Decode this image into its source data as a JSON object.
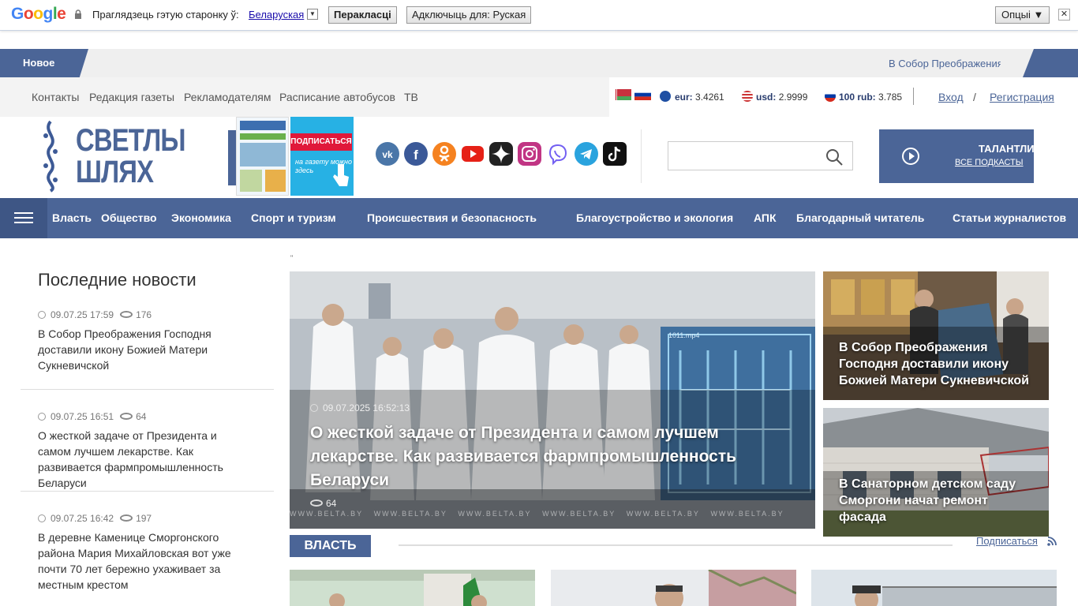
{
  "translate_bar": {
    "logo": "Google",
    "prompt": "Праглядзець гэтую старонку ў:",
    "language": "Беларуская",
    "translate_button": "Перакласці",
    "disable_button": "Адключыць для: Руская",
    "options_button": "Опцыі ▼",
    "close_label": "✕"
  },
  "ticker": {
    "label": "Новое",
    "text": "В Собор Преображения Господня доставили икону Божией Матери Сукневичской"
  },
  "top_links": [
    "Контакты",
    "Редакция газеты",
    "Рекламодателям",
    "Расписание автобусов",
    "ТВ"
  ],
  "rates": {
    "eur_label": "eur:",
    "eur_value": "3.4261",
    "usd_label": "usd:",
    "usd_value": "2.9999",
    "rub_label": "100 rub:",
    "rub_value": "3.785",
    "login": "Вход",
    "slash": "/",
    "register": "Регистрация"
  },
  "logo": {
    "line1": "СВЕТЛЫ",
    "line2": "ШЛЯХ"
  },
  "promo": {
    "subscribe": "ПОДПИСАТЬСЯ",
    "hint": "на газету можно здесь"
  },
  "socials": [
    "vk-icon",
    "facebook-icon",
    "odnoklassniki-icon",
    "youtube-icon",
    "dzen-icon",
    "instagram-icon",
    "viber-icon",
    "telegram-icon",
    "tiktok-icon"
  ],
  "search": {
    "placeholder": ""
  },
  "podcast": {
    "title": "ТАЛАНТЛИВЫЕ",
    "all_link": "ВСЕ ПОДКАСТЫ"
  },
  "nav": [
    "Власть",
    "Общество",
    "Экономика",
    "Спорт и туризм",
    "Происшествия и безопасность",
    "Благоустройство и экология",
    "АПК",
    "Благодарный читатель",
    "Статьи журналистов"
  ],
  "last_news": {
    "title": "Последние новости",
    "items": [
      {
        "date": "09.07.25 17:59",
        "views": "176",
        "title": "В Собор Преображения Господня доставили икону Божией Матери Сукневичской"
      },
      {
        "date": "09.07.25 16:51",
        "views": "64",
        "title": "О жесткой задаче от Президента и самом лучшем лекарстве. Как развивается фармпромышленность Беларуси"
      },
      {
        "date": "09.07.25 16:42",
        "views": "197",
        "title": "В деревне Каменице Сморгонского района Мария Михайловская вот уже почти 70 лет бережно ухаживает за местным крестом"
      }
    ]
  },
  "feature": {
    "quote_mark": "\"",
    "date": "09.07.2025 16:52:13",
    "title": "О жесткой задаче от Президента и самом лучшем лекарстве. Как развивается фармпромышленность Беларуси",
    "views": "64",
    "watermark": "WWW.BELTA.BY",
    "screen_label": "1011.mp4"
  },
  "side_news": [
    {
      "title": "В Собор Преображения Господня доставили икону Божией Матери Сукневичской"
    },
    {
      "title": "В Санаторном детском саду Сморгони начат ремонт фасада"
    }
  ],
  "section": {
    "label": "ВЛАСТЬ",
    "subscribe": "Подписаться"
  }
}
